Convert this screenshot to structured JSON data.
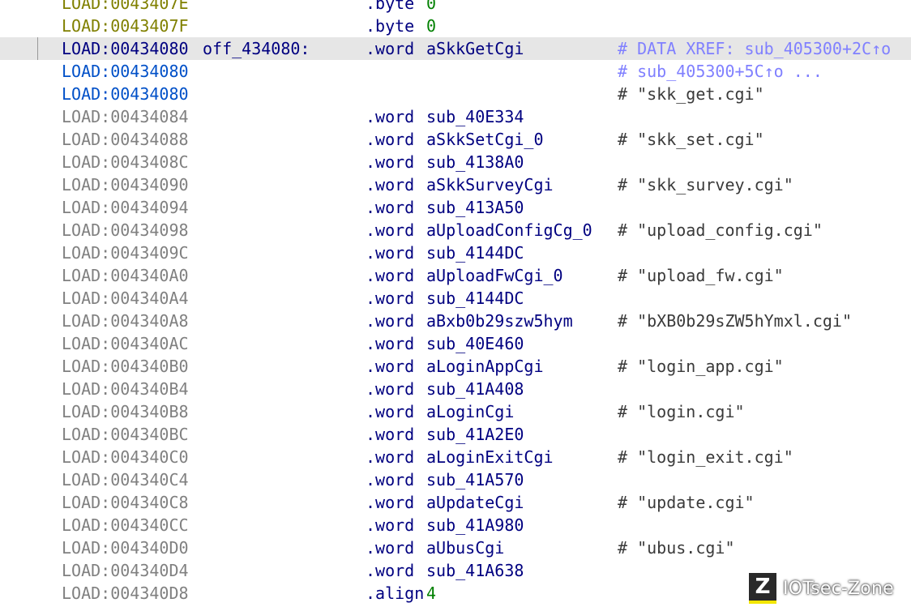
{
  "rows": [
    {
      "addr": "LOAD:0043407E",
      "addr_style": "olive",
      "label": "",
      "mnem": ".byte",
      "oper": "0",
      "oper_style": "green",
      "comment": "",
      "comment_style": "plain",
      "highlight": false
    },
    {
      "addr": "LOAD:0043407F",
      "addr_style": "olive",
      "label": "",
      "mnem": ".byte",
      "oper": "0",
      "oper_style": "green",
      "comment": "",
      "comment_style": "plain",
      "highlight": false
    },
    {
      "addr": "LOAD:00434080",
      "addr_style": "navy",
      "label": "off_434080:",
      "mnem": ".word",
      "oper": "aSkkGetCgi",
      "oper_style": "navy",
      "comment": "# DATA XREF: sub_405300+2C↑o",
      "comment_style": "xref",
      "highlight": true
    },
    {
      "addr": "LOAD:00434080",
      "addr_style": "blue",
      "label": "",
      "mnem": "",
      "oper": "",
      "oper_style": "navy",
      "comment": "# sub_405300+5C↑o ...",
      "comment_style": "xref",
      "highlight": false
    },
    {
      "addr": "LOAD:00434080",
      "addr_style": "blue",
      "label": "",
      "mnem": "",
      "oper": "",
      "oper_style": "navy",
      "comment": "# \"skk_get.cgi\"",
      "comment_style": "plain",
      "highlight": false
    },
    {
      "addr": "LOAD:00434084",
      "addr_style": "gray",
      "label": "",
      "mnem": ".word",
      "oper": "sub_40E334",
      "oper_style": "navy",
      "comment": "",
      "comment_style": "plain",
      "highlight": false
    },
    {
      "addr": "LOAD:00434088",
      "addr_style": "gray",
      "label": "",
      "mnem": ".word",
      "oper": "aSkkSetCgi_0",
      "oper_style": "navy",
      "comment": "# \"skk_set.cgi\"",
      "comment_style": "plain",
      "highlight": false
    },
    {
      "addr": "LOAD:0043408C",
      "addr_style": "gray",
      "label": "",
      "mnem": ".word",
      "oper": "sub_4138A0",
      "oper_style": "navy",
      "comment": "",
      "comment_style": "plain",
      "highlight": false
    },
    {
      "addr": "LOAD:00434090",
      "addr_style": "gray",
      "label": "",
      "mnem": ".word",
      "oper": "aSkkSurveyCgi",
      "oper_style": "navy",
      "comment": "# \"skk_survey.cgi\"",
      "comment_style": "plain",
      "highlight": false
    },
    {
      "addr": "LOAD:00434094",
      "addr_style": "gray",
      "label": "",
      "mnem": ".word",
      "oper": "sub_413A50",
      "oper_style": "navy",
      "comment": "",
      "comment_style": "plain",
      "highlight": false
    },
    {
      "addr": "LOAD:00434098",
      "addr_style": "gray",
      "label": "",
      "mnem": ".word",
      "oper": "aUploadConfigCg_0",
      "oper_style": "navy",
      "comment": "# \"upload_config.cgi\"",
      "comment_style": "plain",
      "highlight": false
    },
    {
      "addr": "LOAD:0043409C",
      "addr_style": "gray",
      "label": "",
      "mnem": ".word",
      "oper": "sub_4144DC",
      "oper_style": "navy",
      "comment": "",
      "comment_style": "plain",
      "highlight": false
    },
    {
      "addr": "LOAD:004340A0",
      "addr_style": "gray",
      "label": "",
      "mnem": ".word",
      "oper": "aUploadFwCgi_0",
      "oper_style": "navy",
      "comment": "# \"upload_fw.cgi\"",
      "comment_style": "plain",
      "highlight": false
    },
    {
      "addr": "LOAD:004340A4",
      "addr_style": "gray",
      "label": "",
      "mnem": ".word",
      "oper": "sub_4144DC",
      "oper_style": "navy",
      "comment": "",
      "comment_style": "plain",
      "highlight": false
    },
    {
      "addr": "LOAD:004340A8",
      "addr_style": "gray",
      "label": "",
      "mnem": ".word",
      "oper": "aBxb0b29szw5hym",
      "oper_style": "navy",
      "comment": "# \"bXB0b29sZW5hYmxl.cgi\"",
      "comment_style": "plain",
      "highlight": false
    },
    {
      "addr": "LOAD:004340AC",
      "addr_style": "gray",
      "label": "",
      "mnem": ".word",
      "oper": "sub_40E460",
      "oper_style": "navy",
      "comment": "",
      "comment_style": "plain",
      "highlight": false
    },
    {
      "addr": "LOAD:004340B0",
      "addr_style": "gray",
      "label": "",
      "mnem": ".word",
      "oper": "aLoginAppCgi",
      "oper_style": "navy",
      "comment": "# \"login_app.cgi\"",
      "comment_style": "plain",
      "highlight": false
    },
    {
      "addr": "LOAD:004340B4",
      "addr_style": "gray",
      "label": "",
      "mnem": ".word",
      "oper": "sub_41A408",
      "oper_style": "navy",
      "comment": "",
      "comment_style": "plain",
      "highlight": false
    },
    {
      "addr": "LOAD:004340B8",
      "addr_style": "gray",
      "label": "",
      "mnem": ".word",
      "oper": "aLoginCgi",
      "oper_style": "navy",
      "comment": "# \"login.cgi\"",
      "comment_style": "plain",
      "highlight": false
    },
    {
      "addr": "LOAD:004340BC",
      "addr_style": "gray",
      "label": "",
      "mnem": ".word",
      "oper": "sub_41A2E0",
      "oper_style": "navy",
      "comment": "",
      "comment_style": "plain",
      "highlight": false
    },
    {
      "addr": "LOAD:004340C0",
      "addr_style": "gray",
      "label": "",
      "mnem": ".word",
      "oper": "aLoginExitCgi",
      "oper_style": "navy",
      "comment": "# \"login_exit.cgi\"",
      "comment_style": "plain",
      "highlight": false
    },
    {
      "addr": "LOAD:004340C4",
      "addr_style": "gray",
      "label": "",
      "mnem": ".word",
      "oper": "sub_41A570",
      "oper_style": "navy",
      "comment": "",
      "comment_style": "plain",
      "highlight": false
    },
    {
      "addr": "LOAD:004340C8",
      "addr_style": "gray",
      "label": "",
      "mnem": ".word",
      "oper": "aUpdateCgi",
      "oper_style": "navy",
      "comment": "# \"update.cgi\"",
      "comment_style": "plain",
      "highlight": false
    },
    {
      "addr": "LOAD:004340CC",
      "addr_style": "gray",
      "label": "",
      "mnem": ".word",
      "oper": "sub_41A980",
      "oper_style": "navy",
      "comment": "",
      "comment_style": "plain",
      "highlight": false
    },
    {
      "addr": "LOAD:004340D0",
      "addr_style": "gray",
      "label": "",
      "mnem": ".word",
      "oper": "aUbusCgi",
      "oper_style": "navy",
      "comment": "# \"ubus.cgi\"",
      "comment_style": "plain",
      "highlight": false
    },
    {
      "addr": "LOAD:004340D4",
      "addr_style": "gray",
      "label": "",
      "mnem": ".word",
      "oper": "sub_41A638",
      "oper_style": "navy",
      "comment": "",
      "comment_style": "plain",
      "highlight": false
    },
    {
      "addr": "LOAD:004340D8",
      "addr_style": "gray",
      "label": "",
      "mnem": ".align",
      "oper": "4",
      "oper_style": "green",
      "comment": "",
      "comment_style": "plain",
      "highlight": false
    }
  ],
  "watermark": {
    "badge": "Z",
    "text": "IOTsec-Zone",
    "icon": "iotsec-zone-logo-icon",
    "accent": "#f2e600"
  }
}
